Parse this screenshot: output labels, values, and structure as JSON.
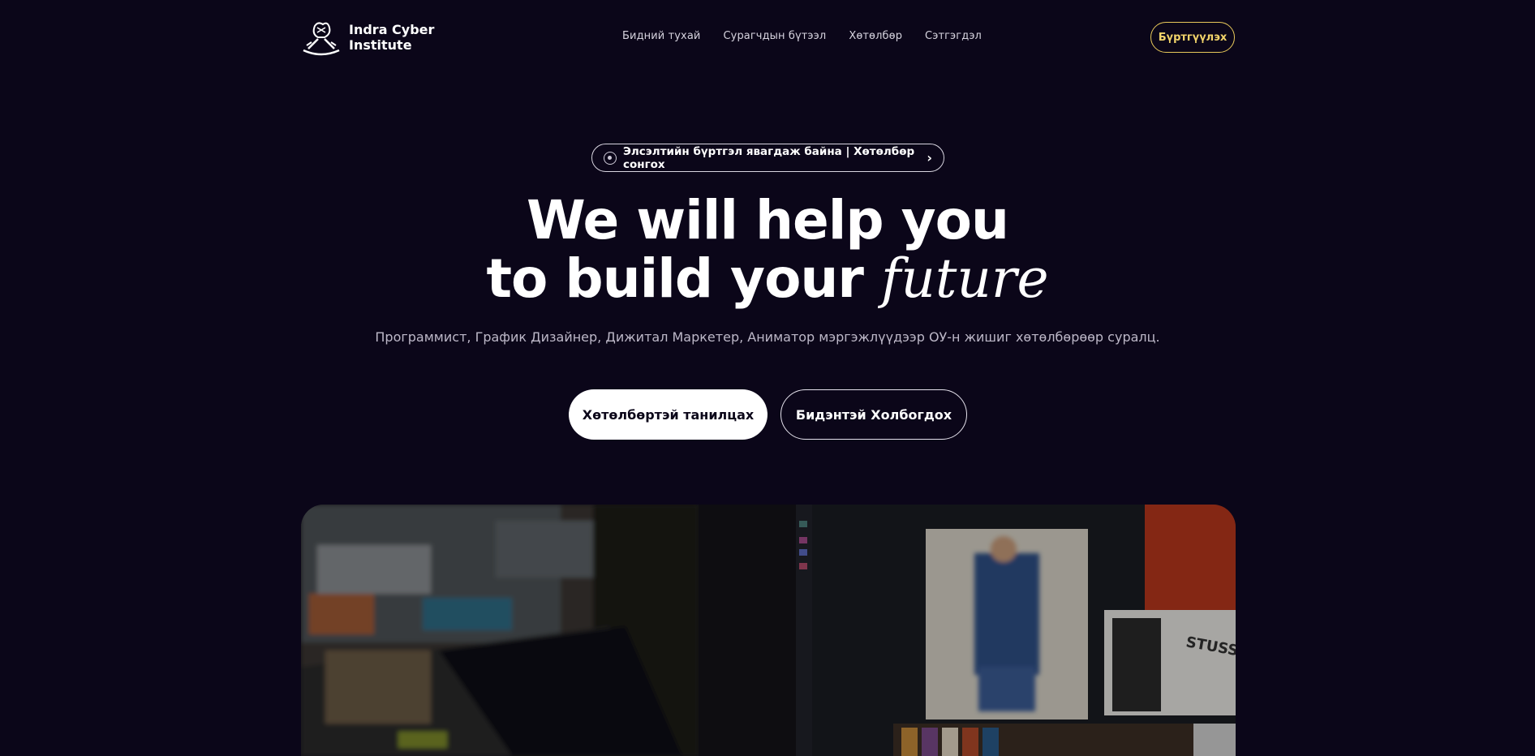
{
  "brand": {
    "name_line1": "Indra Cyber",
    "name_line2": "Institute"
  },
  "nav": {
    "items": [
      {
        "label": "Бидний тухай"
      },
      {
        "label": "Сурагчдын бүтээл"
      },
      {
        "label": "Хөтөлбөр"
      },
      {
        "label": "Сэтгэгдэл"
      }
    ],
    "register_label": "Бүртгүүлэх"
  },
  "announcement": {
    "text": "Элсэлтийн бүртгэл явагдаж байна | Хөтөлбөр сонгох",
    "icon": "radio-dot-icon",
    "arrow_icon": "chevron-right-icon"
  },
  "hero": {
    "title_line1": "We will help you",
    "title_line2_prefix": "to build your",
    "title_line2_accent": "future",
    "subtitle": "Программист, График Дизайнер, Дижитал Маркетер, Аниматор мэргэжлүүдээр ОУ-н жишиг хөтөлбөрөөр суралц.",
    "primary_cta": "Хөтөлбөртэй танилцах",
    "secondary_cta": "Бидэнтэй Холбогдох"
  },
  "colors": {
    "background": "#0b0619",
    "accent_gold": "#e8c95a",
    "text_muted": "#bdb8c8"
  }
}
